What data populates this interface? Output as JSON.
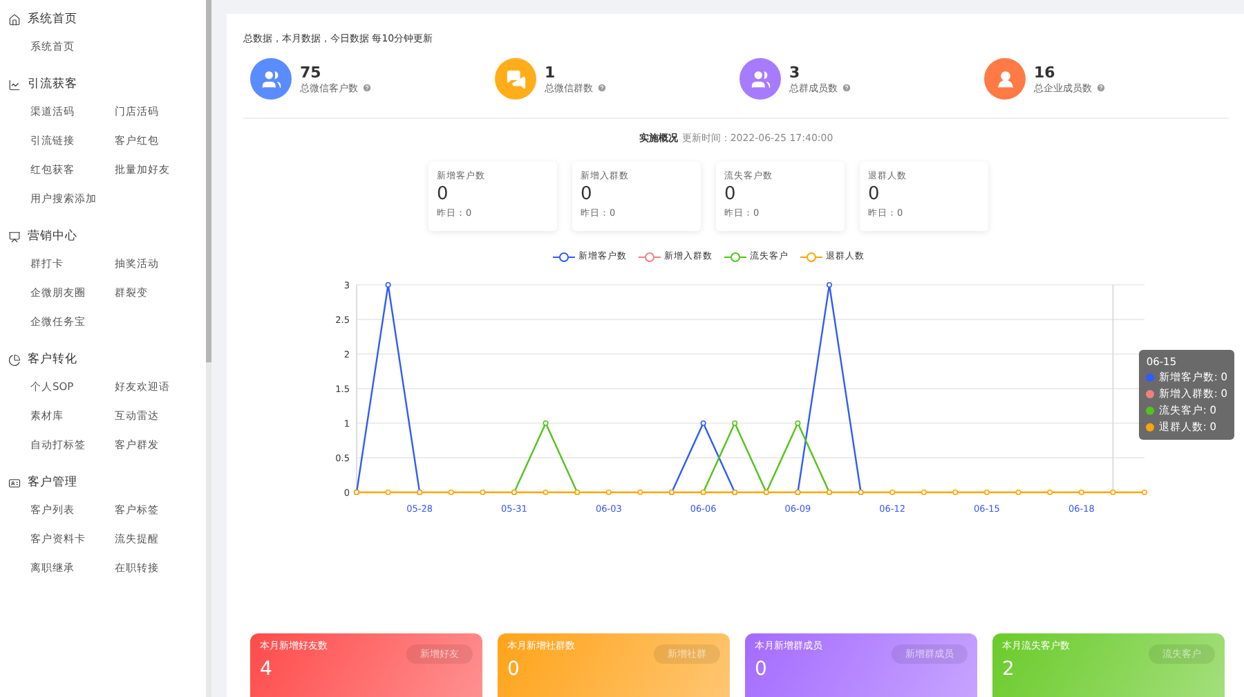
{
  "sidebar": {
    "sections": [
      {
        "title": "系统首页",
        "items": [
          "系统首页"
        ]
      },
      {
        "title": "引流获客",
        "items": [
          "渠道活码",
          "门店活码",
          "引流链接",
          "客户红包",
          "红包获客",
          "批量加好友",
          "用户搜索添加"
        ]
      },
      {
        "title": "营销中心",
        "items": [
          "群打卡",
          "抽奖活动",
          "企微朋友圈",
          "群裂变",
          "企微任务宝"
        ]
      },
      {
        "title": "客户转化",
        "items": [
          "个人SOP",
          "好友欢迎语",
          "素材库",
          "互动雷达",
          "自动打标签",
          "客户群发"
        ]
      },
      {
        "title": "客户管理",
        "items": [
          "客户列表",
          "客户标签",
          "客户资料卡",
          "流失提醒",
          "离职继承",
          "在职转接"
        ]
      }
    ]
  },
  "stats_note": "总数据，本月数据，今日数据 每10分钟更新",
  "stats": [
    {
      "value": "75",
      "label": "总微信客户数",
      "color": "#5b8cff"
    },
    {
      "value": "1",
      "label": "总微信群数",
      "color": "#ffae1a"
    },
    {
      "value": "3",
      "label": "总群成员数",
      "color": "#a77bff"
    },
    {
      "value": "16",
      "label": "总企业成员数",
      "color": "#ff7a45"
    }
  ],
  "realtime": {
    "title": "实施概况",
    "update_time": "更新时间：2022-06-25 17:40:00"
  },
  "today_cards": [
    {
      "label": "新增客户数",
      "value": "0",
      "yesterday": "昨日：0"
    },
    {
      "label": "新增入群数",
      "value": "0",
      "yesterday": "昨日：0"
    },
    {
      "label": "流失客户数",
      "value": "0",
      "yesterday": "昨日：0"
    },
    {
      "label": "退群人数",
      "value": "0",
      "yesterday": "昨日：0"
    }
  ],
  "chart_data": {
    "type": "line",
    "categories": [
      null,
      null,
      "05-28",
      null,
      null,
      "05-31",
      null,
      null,
      "06-03",
      null,
      null,
      "06-06",
      null,
      null,
      "06-09",
      null,
      null,
      "06-12",
      null,
      null,
      "06-15",
      null,
      null,
      "06-18",
      null,
      null
    ],
    "ylim": [
      0,
      3
    ],
    "yticks": [
      0,
      0.5,
      1,
      1.5,
      2,
      2.5,
      3
    ],
    "grid": true,
    "series": [
      {
        "name": "新增客户数",
        "color": "#2f5bff",
        "marker": "circle",
        "values": [
          0,
          3,
          0,
          null,
          null,
          null,
          null,
          null,
          null,
          null,
          0,
          1,
          0,
          null,
          0,
          3,
          0,
          null,
          null,
          null,
          null,
          null,
          null,
          null,
          null,
          null
        ]
      },
      {
        "name": "新增入群数",
        "color": "#f08080",
        "marker": "circle",
        "values": [
          null,
          null,
          null,
          null,
          null,
          null,
          null,
          null,
          null,
          null,
          null,
          null,
          null,
          null,
          null,
          null,
          null,
          null,
          null,
          null,
          null,
          null,
          null,
          null,
          null,
          null
        ]
      },
      {
        "name": "流失客户",
        "color": "#52c41a",
        "marker": "circle",
        "values": [
          null,
          null,
          null,
          null,
          null,
          0,
          1,
          0,
          null,
          null,
          null,
          0,
          1,
          0,
          1,
          0,
          null,
          null,
          null,
          null,
          null,
          null,
          null,
          null,
          null,
          null
        ]
      },
      {
        "name": "退群人数",
        "color": "#ffa500",
        "marker": "circle",
        "values": [
          0,
          0,
          0,
          0,
          0,
          0,
          0,
          0,
          0,
          0,
          0,
          0,
          0,
          0,
          0,
          0,
          0,
          0,
          0,
          0,
          0,
          0,
          0,
          0,
          0,
          0
        ]
      }
    ]
  },
  "tooltip": {
    "date": "06-15",
    "items": [
      {
        "label": "新增客户数: 0",
        "color": "#2f5bff"
      },
      {
        "label": "新增入群数: 0",
        "color": "#f08080"
      },
      {
        "label": "流失客户: 0",
        "color": "#52c41a"
      },
      {
        "label": "退群人数: 0",
        "color": "#ffa500"
      }
    ]
  },
  "month_cards": [
    {
      "title": "本月新增好友数",
      "value": "4",
      "button": "新增好友",
      "color": "#ff4b4b"
    },
    {
      "title": "本月新增社群数",
      "value": "0",
      "button": "新增社群",
      "color": "#ffa31a"
    },
    {
      "title": "本月新增群成员",
      "value": "0",
      "button": "新增群成员",
      "color": "#a46bff"
    },
    {
      "title": "本月流失客户数",
      "value": "2",
      "button": "流失客户",
      "color": "#6acb2a"
    }
  ]
}
